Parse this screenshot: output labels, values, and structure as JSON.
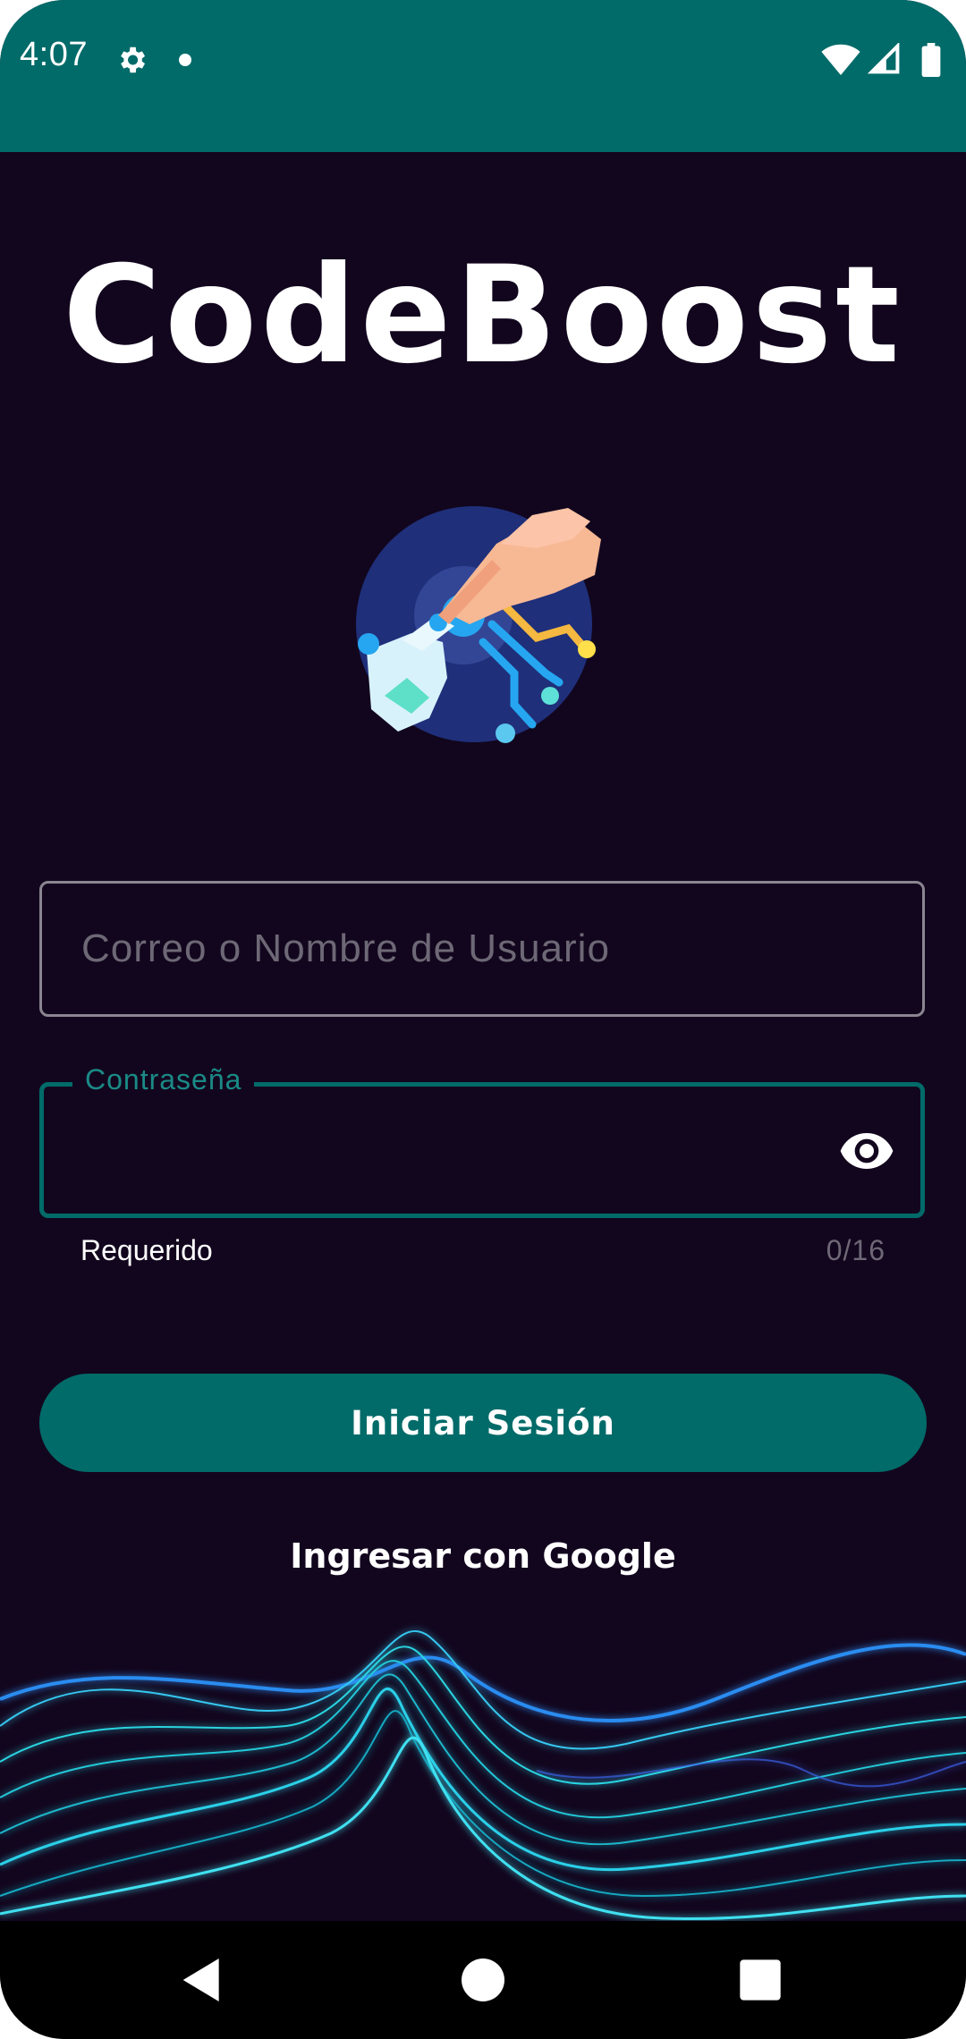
{
  "status_bar": {
    "time": "4:07",
    "icons": [
      "settings-icon",
      "notification-dot-icon",
      "wifi-icon",
      "cell-signal-icon",
      "battery-icon"
    ]
  },
  "app": {
    "title": "CodeBoost",
    "logo_icon": "hand-circuit-logo-icon"
  },
  "login_form": {
    "username_placeholder": "Correo o Nombre de Usuario",
    "username_value": "",
    "password_label": "Contraseña",
    "password_value": "",
    "password_helper": "Requerido",
    "password_counter": "0/16",
    "visibility_icon": "eye-icon"
  },
  "actions": {
    "login_label": "Iniciar Sesión",
    "google_label": "Ingresar con Google"
  },
  "nav": {
    "icons": [
      "back-icon",
      "home-icon",
      "recents-icon"
    ]
  },
  "colors": {
    "background": "#12061e",
    "accent": "#016b69",
    "input_border": "#8a8590",
    "label": "#1a8a86"
  }
}
